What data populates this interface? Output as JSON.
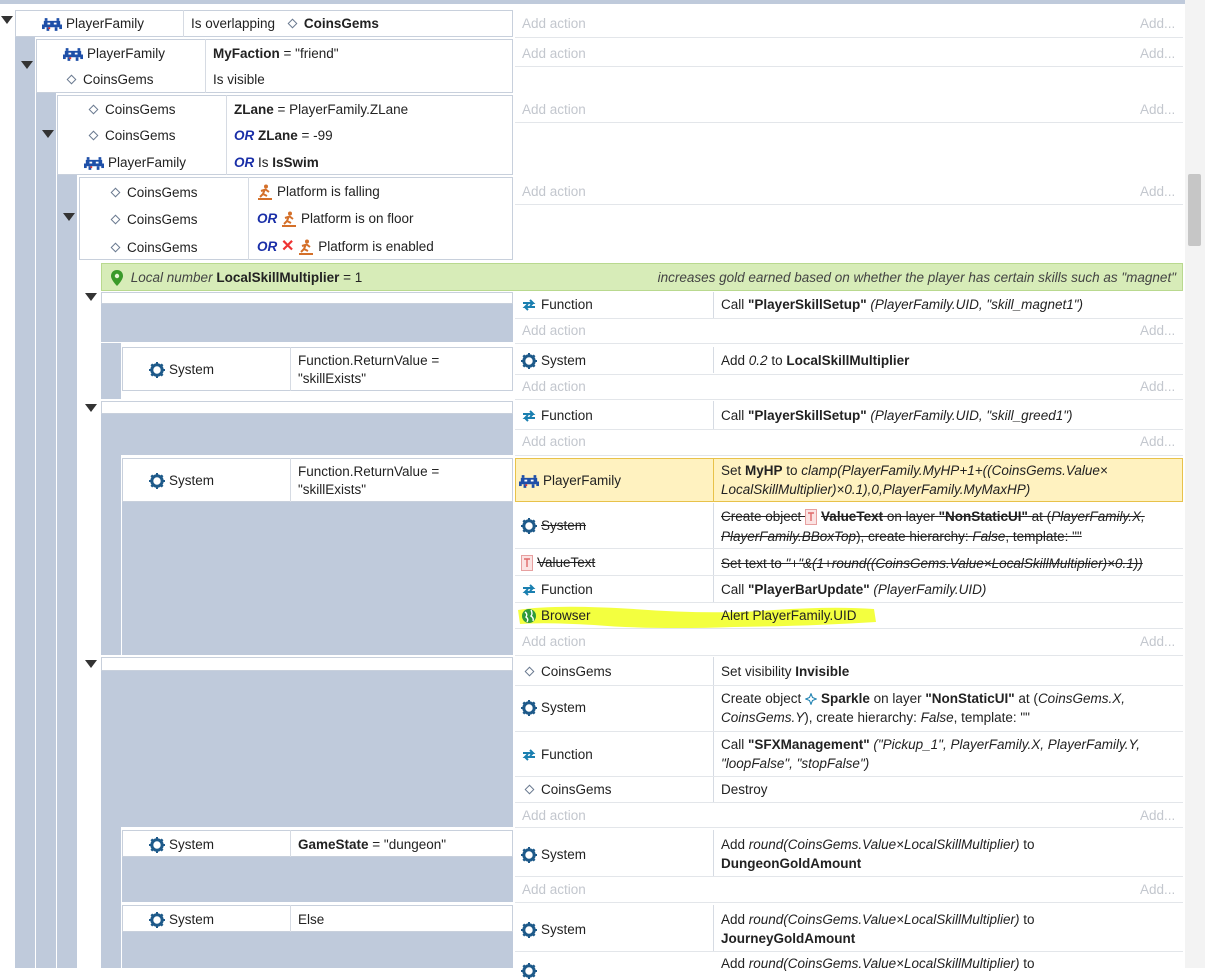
{
  "ui": {
    "add_action": "Add action",
    "add_dots": "Add...",
    "or": "OR",
    "accent_highlight": "#fff2c0",
    "marker_color": "#f2ff2a",
    "comment_bg": "#d7ecb8"
  },
  "ev1": {
    "obj": "PlayerFamily",
    "cond": "Is overlapping",
    "target": "CoinsGems"
  },
  "ev2": {
    "c1_obj": "PlayerFamily",
    "c1_var": "MyFaction",
    "c1_rest": " = \"friend\"",
    "c2_obj": "CoinsGems",
    "c2_text": "Is visible"
  },
  "ev3": {
    "c1_obj": "CoinsGems",
    "c1_var": "ZLane",
    "c1_rest": " = PlayerFamily.ZLane",
    "c2_obj": "CoinsGems",
    "c2_var": "ZLane",
    "c2_rest": " = -99",
    "c3_obj": "PlayerFamily",
    "c3_pre": "Is ",
    "c3_var": "IsSwim"
  },
  "ev4": {
    "c1_obj": "CoinsGems",
    "c1_text": "Platform is falling",
    "c2_obj": "CoinsGems",
    "c2_text": "Platform is on floor",
    "c3_obj": "CoinsGems",
    "c3_text": "Platform is enabled"
  },
  "local": {
    "label": "Local number",
    "name": "LocalSkillMultiplier",
    "value": " = 1",
    "comment": "increases gold earned based on whether the player has certain skills such as \"magnet\""
  },
  "fn1": {
    "obj": "Function",
    "pre": "Call ",
    "name": "\"PlayerSkillSetup\"",
    "args": " (PlayerFamily.UID, \"skill_magnet1\")"
  },
  "sub1": {
    "obj": "System",
    "cond1": "Function.ReturnValue =",
    "cond2": "\"skillExists\"",
    "act_obj": "System",
    "act_pre": "Add ",
    "act_val": "0.2",
    "act_mid": " to ",
    "act_target": "LocalSkillMultiplier"
  },
  "fn2": {
    "obj": "Function",
    "pre": "Call ",
    "name": "\"PlayerSkillSetup\"",
    "args": " (PlayerFamily.UID, \"skill_greed1\")"
  },
  "sub2": {
    "obj": "System",
    "cond1": "Function.ReturnValue =",
    "cond2": "\"skillExists\"",
    "a1_obj": "PlayerFamily",
    "a1_pre": "Set ",
    "a1_var": "MyHP",
    "a1_mid": " to ",
    "a1_expr1": "clamp(PlayerFamily.MyHP+1+((CoinsGems.Value×",
    "a1_expr2": "LocalSkillMultiplier)×0.1),0,PlayerFamily.MyMaxHP)",
    "a2_obj": "System",
    "a2_pre": "Create object ",
    "a2_name": "ValueText",
    "a2_mid": " on layer ",
    "a2_layer": "\"NonStaticUI\"",
    "a2_at": " at (",
    "a2_xy": "PlayerFamily.X,",
    "a2_line2a": "PlayerFamily.BBoxTop",
    "a2_line2b": "), create hierarchy: ",
    "a2_false": "False",
    "a2_tpl": ", template: \"\"",
    "a3_obj": "ValueText",
    "a3_text": "Set text to ",
    "a3_expr": "\"+\"&(1+round((CoinsGems.Value×LocalSkillMultiplier)×0.1))",
    "a4_obj": "Function",
    "a4_pre": "Call ",
    "a4_name": "\"PlayerBarUpdate\"",
    "a4_args": " (PlayerFamily.UID)",
    "a5_obj": "Browser",
    "a5_text": "Alert PlayerFamily.UID"
  },
  "blk3": {
    "a1_obj": "CoinsGems",
    "a1_pre": "Set visibility ",
    "a1_val": "Invisible",
    "a2_obj": "System",
    "a2_pre": "Create object ",
    "a2_name": "Sparkle",
    "a2_mid": " on layer ",
    "a2_layer": "\"NonStaticUI\"",
    "a2_at": " at (",
    "a2_xy": "CoinsGems.X,",
    "a2_line2": "CoinsGems.Y",
    "a2_rest": "), create hierarchy: ",
    "a2_false": "False",
    "a2_tpl": ", template: \"\"",
    "a3_obj": "Function",
    "a3_pre": "Call ",
    "a3_name": "\"SFXManagement\"",
    "a3_args": " (\"Pickup_1\", PlayerFamily.X, PlayerFamily.Y,",
    "a3_line2": "\"loopFalse\", \"stopFalse\")",
    "a4_obj": "CoinsGems",
    "a4_text": "Destroy"
  },
  "sub3": {
    "obj": "System",
    "var": "GameState",
    "rest": " = \"dungeon\"",
    "act_obj": "System",
    "act_pre": "Add ",
    "act_expr": "round(CoinsGems.Value×LocalSkillMultiplier)",
    "act_to": " to",
    "act_target": "DungeonGoldAmount"
  },
  "sub4": {
    "obj": "System",
    "cond": "Else",
    "act_obj": "System",
    "act_pre": "Add ",
    "act_expr": "round(CoinsGems.Value×LocalSkillMultiplier)",
    "act_to": " to",
    "act_target": "JourneyGoldAmount",
    "act2_pre": "Add ",
    "act2_expr": "round(CoinsGems.Value×LocalSkillMultiplier)",
    "act2_to": " to"
  }
}
